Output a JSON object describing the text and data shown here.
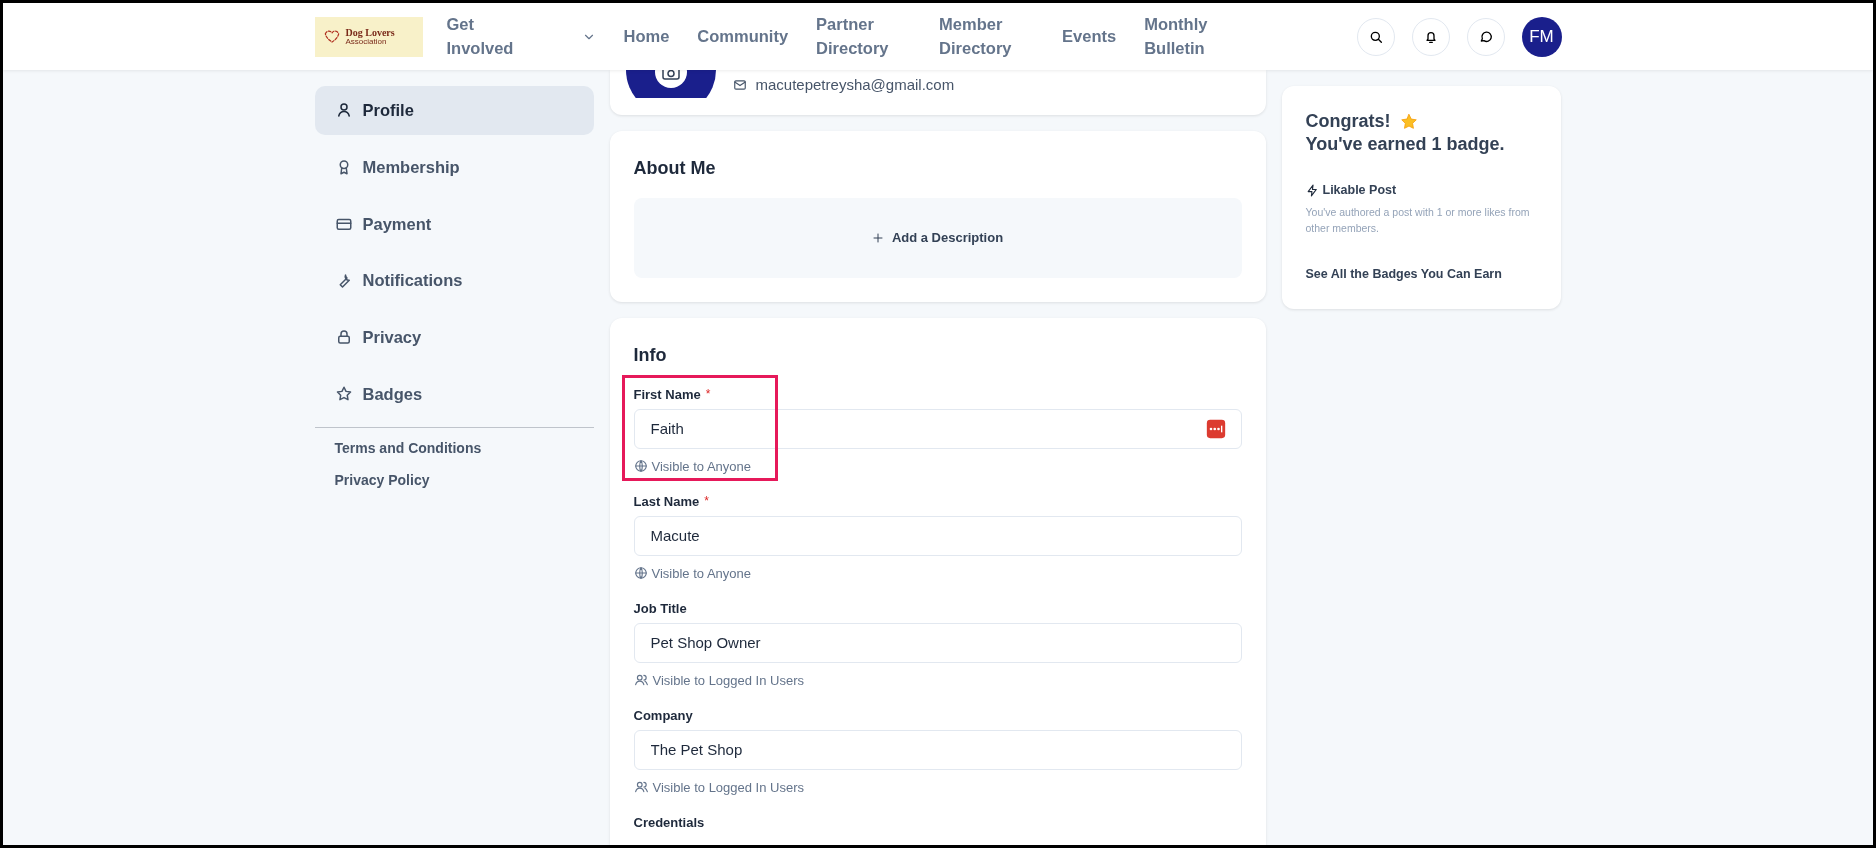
{
  "header": {
    "logo": {
      "title": "Dog Lovers",
      "subtitle": "Association"
    },
    "nav": [
      {
        "label": "Get Involved",
        "dropdown": true
      },
      {
        "label": "Home",
        "dropdown": false
      },
      {
        "label": "Community",
        "dropdown": false
      },
      {
        "label": "Partner Directory",
        "dropdown": false
      },
      {
        "label": "Member Directory",
        "dropdown": false
      },
      {
        "label": "Events",
        "dropdown": false
      },
      {
        "label": "Monthly Bulletin",
        "dropdown": false
      }
    ],
    "user_initials": "FM"
  },
  "sidebar": {
    "items": [
      {
        "label": "Profile",
        "selected": true
      },
      {
        "label": "Membership",
        "selected": false
      },
      {
        "label": "Payment",
        "selected": false
      },
      {
        "label": "Notifications",
        "selected": false
      },
      {
        "label": "Privacy",
        "selected": false
      },
      {
        "label": "Badges",
        "selected": false
      }
    ],
    "links": [
      "Terms and Conditions",
      "Privacy Policy"
    ]
  },
  "profile": {
    "email": "macutepetreysha@gmail.com"
  },
  "about": {
    "title": "About Me",
    "add_label": "Add a Description"
  },
  "info": {
    "title": "Info",
    "fields": [
      {
        "label": "First Name",
        "required_mark": "*",
        "value": "Faith",
        "visibility": "Visible to Anyone",
        "kind": "anyone",
        "highlighted": true,
        "autofill": true
      },
      {
        "label": "Last Name",
        "required_mark": "*",
        "value": "Macute",
        "visibility": "Visible to Anyone",
        "kind": "anyone",
        "highlighted": false,
        "autofill": false
      },
      {
        "label": "Job Title",
        "value": "Pet Shop Owner",
        "visibility": "Visible to Logged In Users",
        "kind": "logged_in",
        "highlighted": false,
        "autofill": false
      },
      {
        "label": "Company",
        "value": "The Pet Shop",
        "visibility": "Visible to Logged In Users",
        "kind": "logged_in",
        "highlighted": false,
        "autofill": false
      },
      {
        "label": "Credentials",
        "highlighted": false
      }
    ]
  },
  "badges": {
    "title": "Congrats!",
    "subtitle": "You've earned 1 badge.",
    "badge_name": "Likable Post",
    "badge_description": "You've authored a post with 1 or more likes from other members.",
    "link": "See All the Badges You Can Earn"
  }
}
